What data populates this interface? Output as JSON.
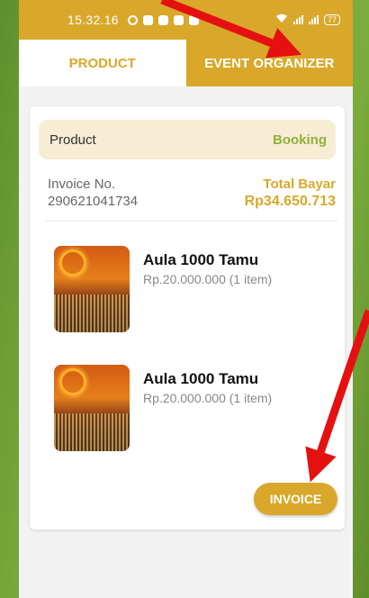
{
  "status_bar": {
    "time": "15.32.16",
    "battery": "77"
  },
  "tabs": [
    {
      "label": "PRODUCT"
    },
    {
      "label": "EVENT ORGANIZER"
    }
  ],
  "summary": {
    "left": "Product",
    "right": "Booking"
  },
  "invoice": {
    "number_label": "Invoice No.",
    "number": "290621041734",
    "total_label": "Total Bayar",
    "total": "Rp34.650.713"
  },
  "items": [
    {
      "title": "Aula 1000 Tamu",
      "price": "Rp.20.000.000 (1 item)"
    },
    {
      "title": "Aula 1000 Tamu",
      "price": "Rp.20.000.000 (1 item)"
    }
  ],
  "invoice_button": {
    "label": "INVOICE"
  },
  "colors": {
    "accent": "#d9a82a",
    "booking": "#8fb040",
    "annotation": "#e51010"
  }
}
